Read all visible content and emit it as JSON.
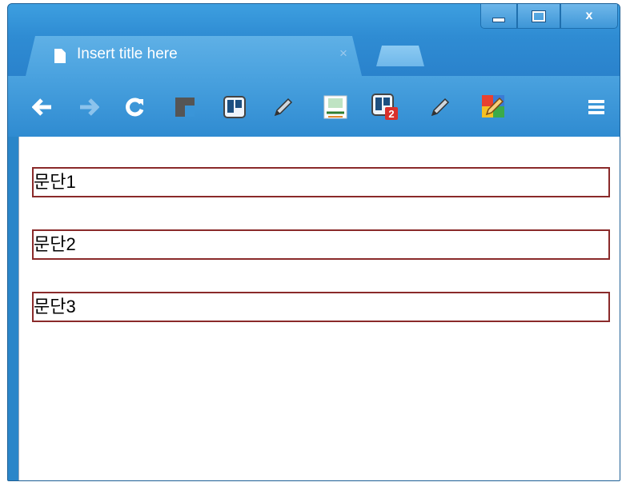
{
  "browser": {
    "tab": {
      "title": "Insert title here",
      "close_glyph": "×"
    },
    "window_controls": {
      "close_glyph": "x"
    },
    "toolbar_icons": [
      "back-arrow-icon",
      "forward-arrow-icon",
      "reload-icon",
      "dark-square-extension-icon",
      "trello-board-icon",
      "pencil-extension-icon",
      "feed-access-icon",
      "trello-notification-icon",
      "pencil-extension-icon-2",
      "colorful-pencil-extension-icon",
      "menu-icon"
    ],
    "colors": {
      "frame": "#2a86c9",
      "toolbar": "#3a95d8",
      "paragraph_border": "#8a2a2a"
    }
  },
  "page": {
    "paragraphs": [
      {
        "text": "문단1"
      },
      {
        "text": "문단2"
      },
      {
        "text": "문단3"
      }
    ],
    "notification_badge": "2"
  }
}
